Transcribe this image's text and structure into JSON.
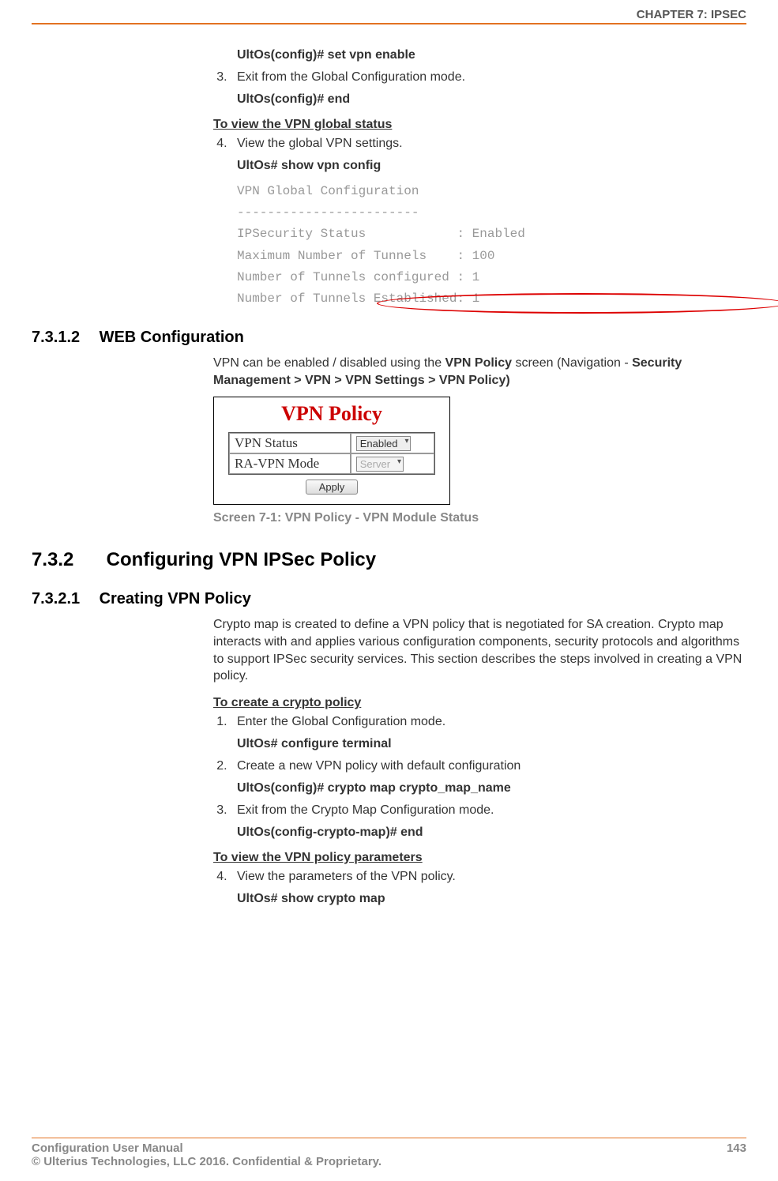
{
  "header": {
    "chapter": "CHAPTER 7: IPSEC"
  },
  "block1": {
    "cmd1": "UltOs(config)# set vpn enable",
    "step3": "Exit from the Global Configuration mode.",
    "cmd2": "UltOs(config)# end",
    "subhead": "To view the VPN global status",
    "step4": "View the global VPN settings.",
    "cmd3": "UltOs# show vpn config",
    "out1": "VPN Global Configuration",
    "out2": "------------------------",
    "out3": "IPSecurity Status            : Enabled",
    "out4": "Maximum Number of Tunnels    : 100",
    "out5": "Number of Tunnels configured : 1",
    "out6": "Number of Tunnels Established: 1"
  },
  "sec7312": {
    "num": "7.3.1.2",
    "title": "WEB Configuration",
    "para_pre": "VPN can be enabled / disabled using the ",
    "bold1": "VPN Policy",
    "para_mid": " screen (Navigation - ",
    "bold2": "Security Management > VPN > VPN Settings > VPN Policy)"
  },
  "figure": {
    "title": "VPN Policy",
    "row1_label": "VPN Status",
    "row1_value": "Enabled",
    "row2_label": "RA-VPN Mode",
    "row2_value": "Server",
    "apply": "Apply",
    "caption": "Screen 7-1: VPN Policy - VPN Module Status"
  },
  "sec732": {
    "num": "7.3.2",
    "title": "Configuring VPN IPSec Policy"
  },
  "sec7321": {
    "num": "7.3.2.1",
    "title": "Creating VPN Policy",
    "para": "Crypto map is created to define a VPN policy that is negotiated for SA creation. Crypto map interacts with and applies various configuration components, security protocols and algorithms to support IPSec security services. This section describes the steps involved in creating a VPN policy.",
    "subhead1": "To create a crypto policy",
    "step1": "Enter the Global Configuration mode.",
    "cmd1": "UltOs# configure terminal",
    "step2": "Create a new VPN policy with default configuration",
    "cmd2": "UltOs(config)# crypto map crypto_map_name",
    "step3": "Exit from the Crypto Map Configuration mode.",
    "cmd3": "UltOs(config-crypto-map)# end",
    "subhead2": "To view the VPN policy parameters",
    "step4": "View the parameters of the VPN policy.",
    "cmd4": "UltOs# show crypto map"
  },
  "footer": {
    "left1": "Configuration User Manual",
    "left2": "© Ulterius Technologies, LLC 2016. Confidential & Proprietary.",
    "page": "143"
  }
}
